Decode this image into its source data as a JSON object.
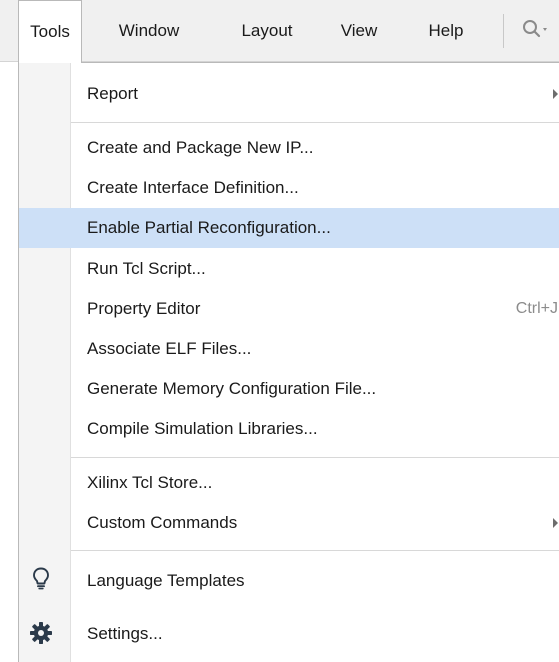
{
  "menubar": {
    "items": [
      "Tools",
      "Window",
      "Layout",
      "View",
      "Help"
    ],
    "active_index": 0,
    "search_icon": "search-icon"
  },
  "menu": {
    "items": [
      {
        "label": "Report",
        "submenu": true
      },
      {
        "label": "Create and Package New IP..."
      },
      {
        "label": "Create Interface Definition..."
      },
      {
        "label": "Enable Partial Reconfiguration...",
        "highlighted": true
      },
      {
        "label": "Run Tcl Script..."
      },
      {
        "label": "Property Editor",
        "shortcut": "Ctrl+J"
      },
      {
        "label": "Associate ELF Files..."
      },
      {
        "label": "Generate Memory Configuration File..."
      },
      {
        "label": "Compile Simulation Libraries..."
      },
      {
        "label": "Xilinx Tcl Store..."
      },
      {
        "label": "Custom Commands",
        "submenu": true
      },
      {
        "label": "Language Templates",
        "icon": "lightbulb-icon"
      },
      {
        "label": "Settings...",
        "icon": "gear-icon"
      }
    ]
  },
  "colors": {
    "highlight": "#cde0f7",
    "menubar_bg": "#f0f0f0",
    "gutter_bg": "#f4f4f4",
    "shortcut_text": "#8c8c8c",
    "icon_dark": "#2b3a4a"
  }
}
